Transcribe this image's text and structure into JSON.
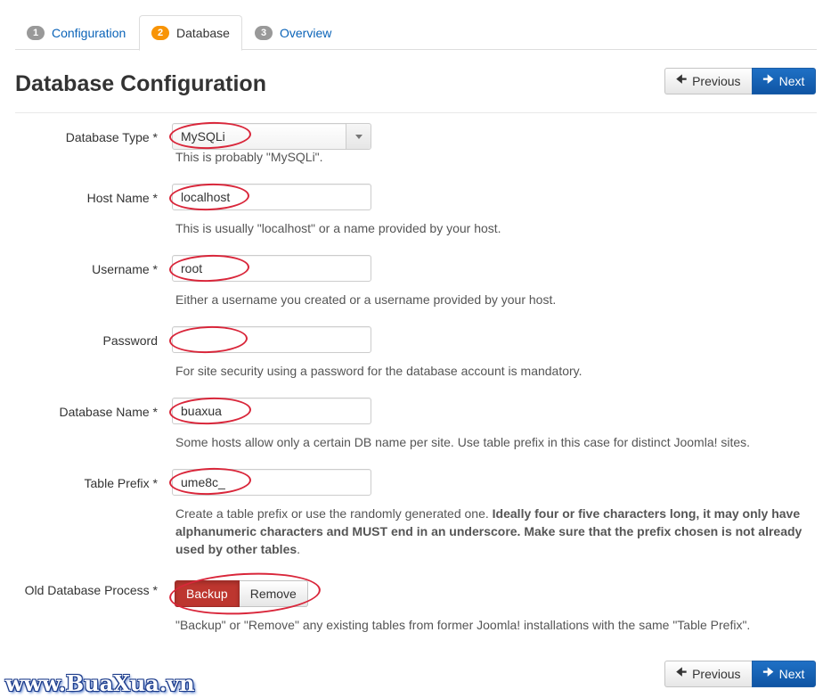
{
  "tabs": [
    {
      "number": "1",
      "label": "Configuration"
    },
    {
      "number": "2",
      "label": "Database"
    },
    {
      "number": "3",
      "label": "Overview"
    }
  ],
  "header": {
    "title": "Database Configuration",
    "previous_label": "Previous",
    "next_label": "Next"
  },
  "form": {
    "db_type": {
      "label": "Database Type *",
      "value": "MySQLi",
      "help": "This is probably \"MySQLi\"."
    },
    "host": {
      "label": "Host Name *",
      "value": "localhost",
      "help": "This is usually \"localhost\" or a name provided by your host."
    },
    "username": {
      "label": "Username *",
      "value": "root",
      "help": "Either a username you created or a username provided by your host."
    },
    "password": {
      "label": "Password",
      "value": "",
      "help": "For site security using a password for the database account is mandatory."
    },
    "db_name": {
      "label": "Database Name *",
      "value": "buaxua",
      "help": "Some hosts allow only a certain DB name per site. Use table prefix in this case for distinct Joomla! sites."
    },
    "prefix": {
      "label": "Table Prefix *",
      "value": "ume8c_",
      "help_plain": "Create a table prefix or use the randomly generated one. ",
      "help_bold": "Ideally four or five characters long, it may only have alphanumeric characters and MUST end in an underscore. Make sure that the prefix chosen is not already used by other tables",
      "help_end": "."
    },
    "old_db": {
      "label": "Old Database Process *",
      "backup_label": "Backup",
      "remove_label": "Remove",
      "selected": "Backup",
      "help": "\"Backup\" or \"Remove\" any existing tables from former Joomla! installations with the same \"Table Prefix\"."
    }
  },
  "footer": {
    "previous_label": "Previous",
    "next_label": "Next"
  },
  "watermark": "www.BuaXua.vn",
  "colors": {
    "link": "#0a63b8",
    "primary": "#1f70c5",
    "danger": "#bd362f",
    "highlight": "#d9263a",
    "badge_active": "#f89406"
  }
}
